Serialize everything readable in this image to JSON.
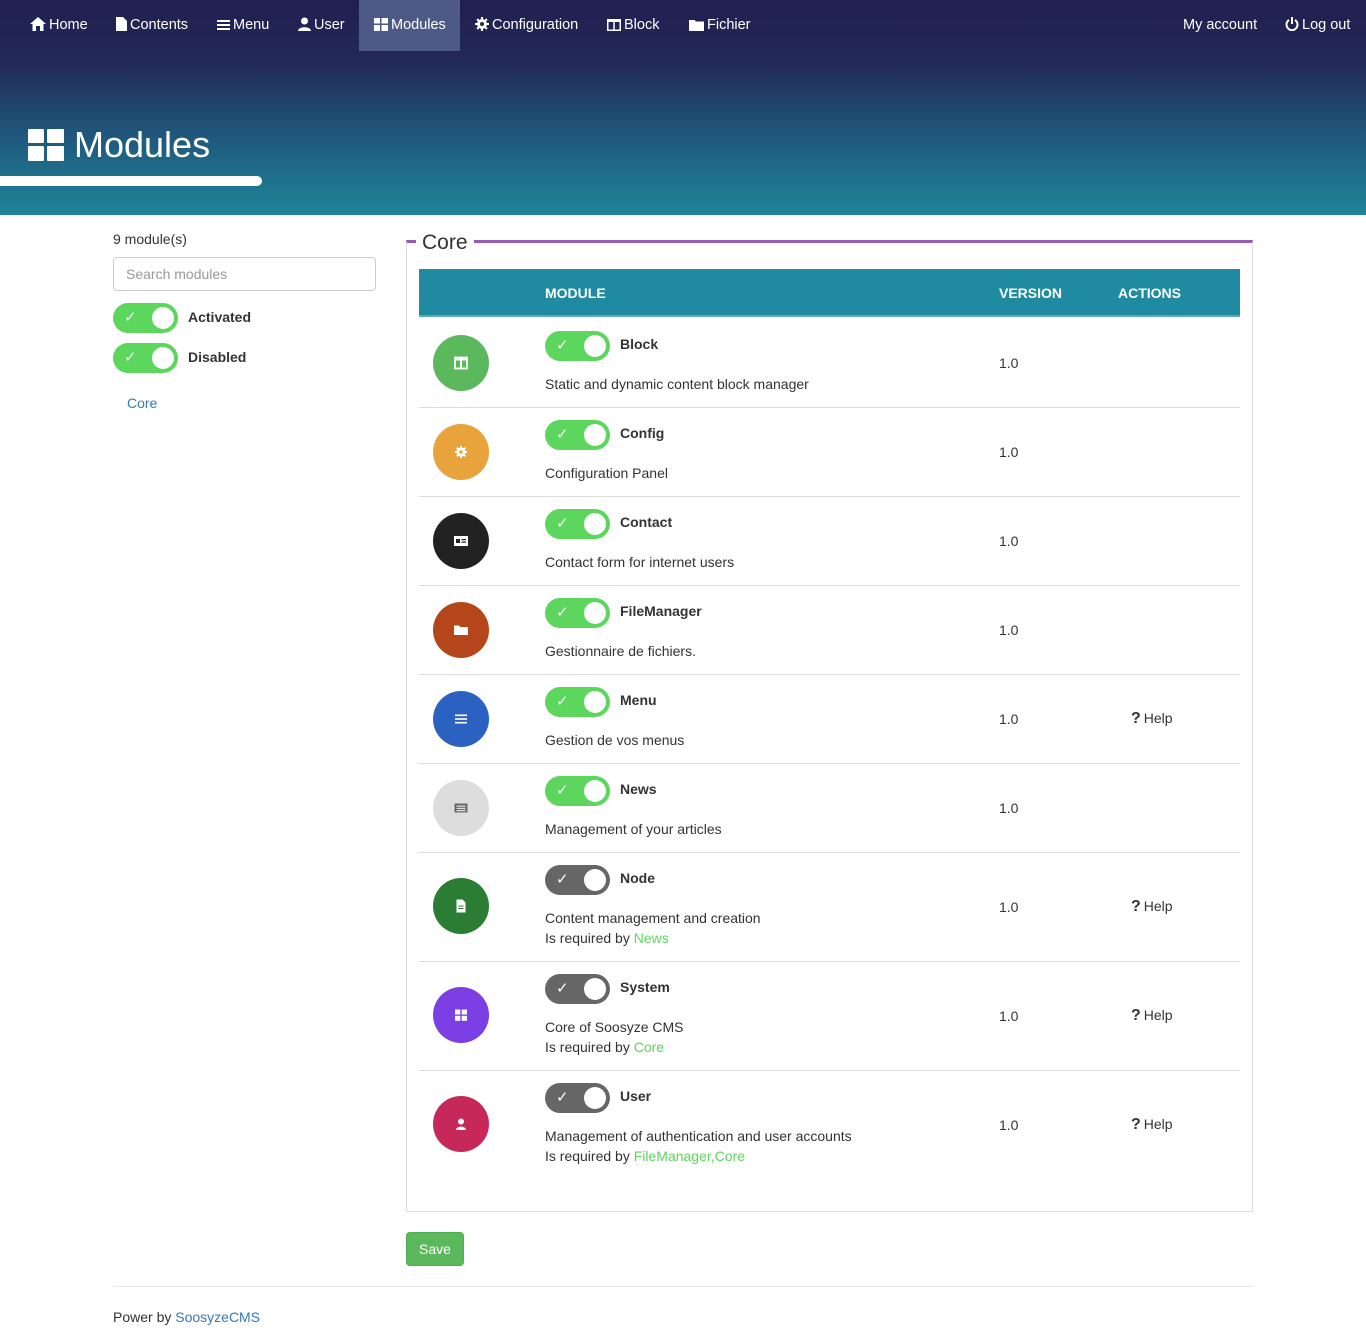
{
  "nav": {
    "home": "Home",
    "contents": "Contents",
    "menu": "Menu",
    "user": "User",
    "modules": "Modules",
    "configuration": "Configuration",
    "block": "Block",
    "fichier": "Fichier",
    "my_account": "My account",
    "logout": "Log out"
  },
  "page": {
    "title": "Modules"
  },
  "sidebar": {
    "count": "9 module(s)",
    "search_placeholder": "Search modules",
    "filters": [
      {
        "label": "Activated"
      },
      {
        "label": "Disabled"
      }
    ],
    "links": [
      "Core"
    ]
  },
  "table": {
    "legend": "Core",
    "headers": {
      "module": "MODULE",
      "version": "VERSION",
      "actions": "ACTIONS"
    },
    "rows": [
      {
        "name": "Block",
        "desc": "Static and dynamic content block manager",
        "version": "1.0",
        "help": "",
        "icon": "block-icon",
        "color": "#5cb85c"
      },
      {
        "name": "Config",
        "desc": "Configuration Panel",
        "version": "1.0",
        "help": "",
        "icon": "gear-icon",
        "color": "#e8a33d"
      },
      {
        "name": "Contact",
        "desc": "Contact form for internet users",
        "version": "1.0",
        "help": "",
        "icon": "contact-card-icon",
        "color": "#222222"
      },
      {
        "name": "FileManager",
        "desc": "Gestionnaire de fichiers.",
        "version": "1.0",
        "help": "",
        "icon": "folder-icon",
        "color": "#b5451b"
      },
      {
        "name": "Menu",
        "desc": "Gestion de vos menus",
        "version": "1.0",
        "help": "Help",
        "icon": "menu-icon",
        "color": "#2b62c2"
      },
      {
        "name": "News",
        "desc": "Management of your articles",
        "version": "1.0",
        "help": "",
        "icon": "newspaper-icon",
        "color": "#dddddd"
      },
      {
        "name": "Node",
        "desc": "Content management and creation",
        "required_prefix": "Is required by",
        "required": "News",
        "version": "1.0",
        "help": "Help",
        "icon": "file-icon",
        "color": "#2a7d32"
      },
      {
        "name": "System",
        "desc": "Core of Soosyze CMS",
        "required_prefix": "Is required by",
        "required": "Core",
        "version": "1.0",
        "help": "Help",
        "icon": "grid-icon",
        "color": "#7b3fe4"
      },
      {
        "name": "User",
        "desc": "Management of authentication and user accounts",
        "required_prefix": "Is required by",
        "required": "FileManager,Core",
        "version": "1.0",
        "help": "Help",
        "icon": "user-icon",
        "color": "#c7285a"
      }
    ]
  },
  "actions": {
    "save": "Save"
  },
  "footer": {
    "prefix": "Power by",
    "link": "SoosyzeCMS"
  },
  "colors": {
    "toggle_on": "#5cd65c",
    "toggle_locked": "#666666",
    "table_header": "#1f8aa0",
    "legend_line": "#9b59b6"
  }
}
